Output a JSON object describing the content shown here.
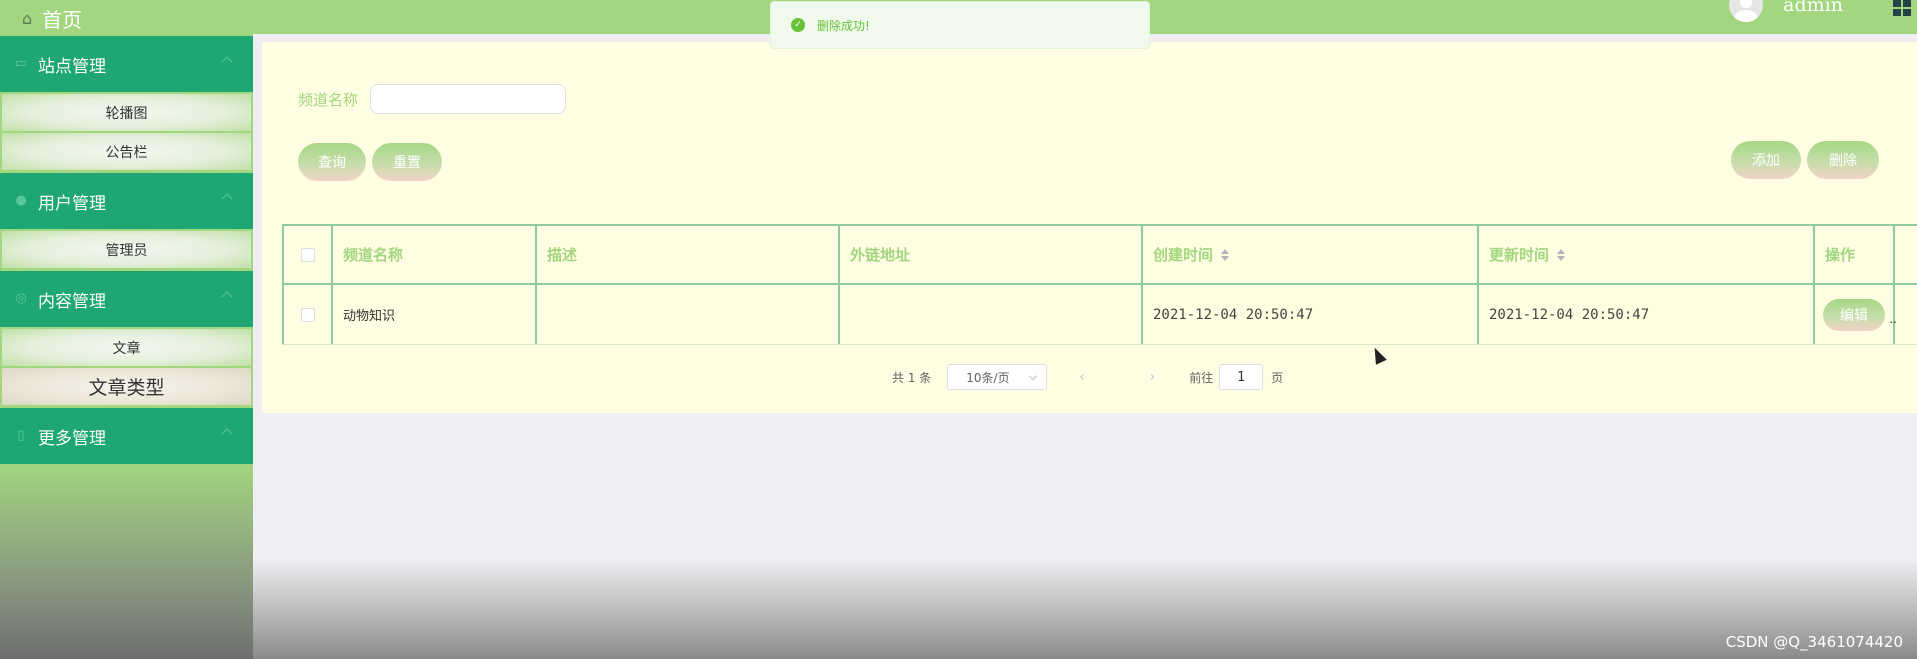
{
  "sidebar": {
    "home_label": "首页",
    "menus": [
      {
        "label": "站点管理",
        "icon": "monitor-icon",
        "items": [
          "轮播图",
          "公告栏"
        ]
      },
      {
        "label": "用户管理",
        "icon": "user-icon",
        "items": [
          "管理员"
        ]
      },
      {
        "label": "内容管理",
        "icon": "content-icon",
        "items": [
          "文章",
          "文章类型"
        ]
      },
      {
        "label": "更多管理",
        "icon": "book-icon",
        "items": []
      }
    ]
  },
  "topbar": {
    "username": "admin"
  },
  "toast": {
    "message": "删除成功!",
    "type": "success",
    "color": "#67c23a"
  },
  "search": {
    "label": "频道名称",
    "value": "",
    "placeholder": ""
  },
  "buttons": {
    "query": "查询",
    "reset": "重置",
    "add": "添加",
    "delete": "删除",
    "edit": "编辑"
  },
  "table": {
    "columns": [
      "频道名称",
      "描述",
      "外链地址",
      "创建时间",
      "更新时间",
      "操作"
    ],
    "rows": [
      {
        "name": "动物知识",
        "description": "",
        "link": "",
        "created": "2021-12-04 20:50:47",
        "updated": "2021-12-04 20:50:47"
      }
    ]
  },
  "pagination": {
    "total": "共 1 条",
    "page_size": "10条/页",
    "goto_label": "前往",
    "page": "1",
    "page_suffix": "页"
  },
  "watermark": "CSDN @Q_3461074420",
  "colors": {
    "accent": "#a2d67f",
    "menu_bg": "#1ea773",
    "panel_bg": "#fffee3"
  }
}
